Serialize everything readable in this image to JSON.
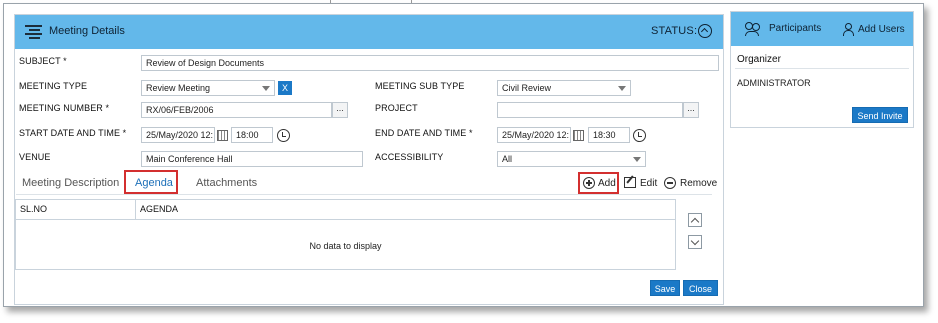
{
  "header": {
    "title": "Meeting Details",
    "status_label": "STATUS:"
  },
  "form": {
    "subject": {
      "label": "SUBJECT *",
      "value": "Review of Design Documents"
    },
    "meeting_type": {
      "label": "MEETING TYPE",
      "value": "Review Meeting",
      "clear": "X"
    },
    "meeting_sub_type": {
      "label": "MEETING SUB TYPE",
      "value": "Civil Review"
    },
    "meeting_number": {
      "label": "MEETING NUMBER *",
      "value": "RX/06/FEB/2006",
      "browse": "..."
    },
    "project": {
      "label": "PROJECT",
      "value": "",
      "browse": "..."
    },
    "start": {
      "label": "START DATE AND TIME *",
      "date": "25/May/2020 12:",
      "time": "18:00"
    },
    "end": {
      "label": "END DATE AND TIME *",
      "date": "25/May/2020 12:",
      "time": "18:30"
    },
    "venue": {
      "label": "VENUE",
      "value": "Main Conference Hall"
    },
    "accessibility": {
      "label": "ACCESSIBILITY",
      "value": "All"
    }
  },
  "tabs": [
    {
      "label": "Meeting Description",
      "active": false
    },
    {
      "label": "Agenda",
      "active": true
    },
    {
      "label": "Attachments",
      "active": false
    }
  ],
  "actions": {
    "add": "Add",
    "edit": "Edit",
    "remove": "Remove"
  },
  "grid": {
    "columns": [
      "SL.NO",
      "AGENDA"
    ],
    "empty_message": "No data to display"
  },
  "footer": {
    "save": "Save",
    "close": "Close"
  },
  "participants": {
    "title": "Participants",
    "add_users": "Add Users",
    "organizer_label": "Organizer",
    "organizer_name": "ADMINISTRATOR",
    "send_invite": "Send Invite"
  },
  "colors": {
    "header_bg": "#63b8ea",
    "button_blue": "#1b79c7",
    "highlight_red": "#d32f2f",
    "active_tab": "#1c6fb8"
  },
  "icons": {
    "menu": "hamburger-icon",
    "status": "chevron-up-circle-icon",
    "participants": "people-icon",
    "add_users": "user-icon",
    "calendar": "calendar-icon",
    "clock": "clock-icon",
    "add": "plus-circle-icon",
    "edit": "edit-icon",
    "remove": "minus-circle-icon"
  }
}
